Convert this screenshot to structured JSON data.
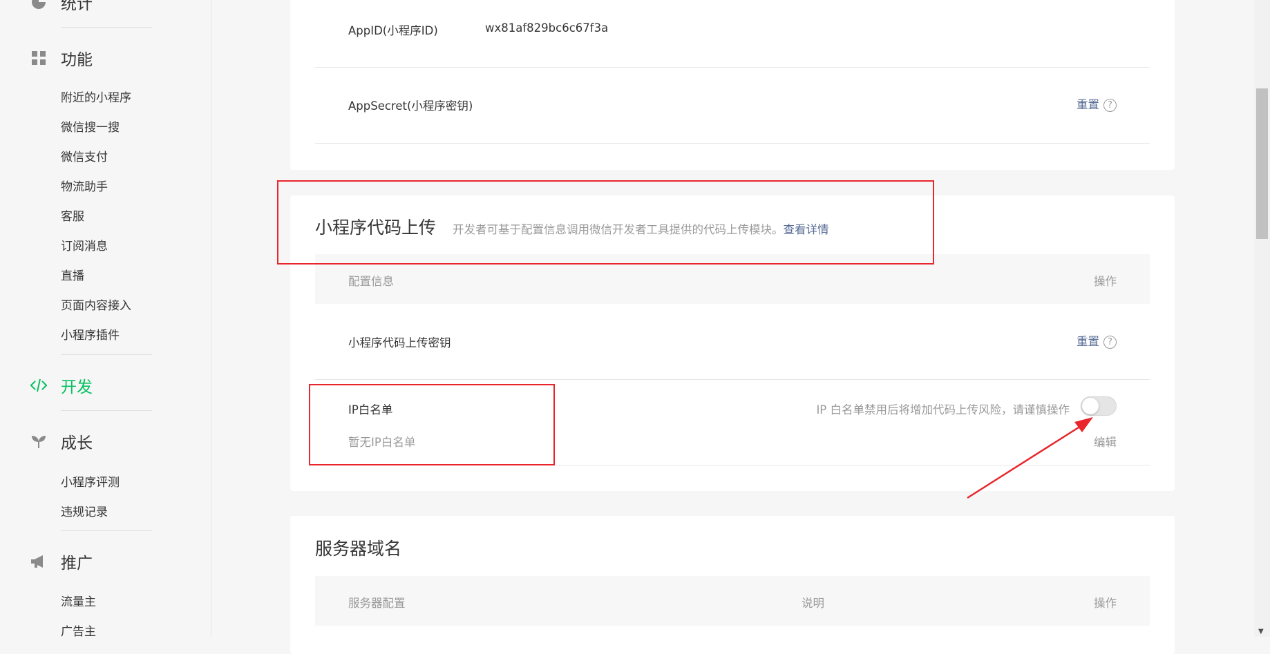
{
  "sidebar": {
    "stats_label": "统计",
    "features": {
      "label": "功能",
      "items": [
        "附近的小程序",
        "微信搜一搜",
        "微信支付",
        "物流助手",
        "客服",
        "订阅消息",
        "直播",
        "页面内容接入",
        "小程序插件"
      ]
    },
    "develop": {
      "label": "开发"
    },
    "growth": {
      "label": "成长",
      "items": [
        "小程序评测",
        "违规记录"
      ]
    },
    "promote": {
      "label": "推广",
      "items": [
        "流量主",
        "广告主"
      ]
    },
    "active_color": "#07c160"
  },
  "account_card": {
    "appid_label": "AppID(小程序ID)",
    "appid_value": "wx81af829bc6c67f3a",
    "appsecret_label": "AppSecret(小程序密钥)",
    "appsecret_action": "重置"
  },
  "upload_card": {
    "title": "小程序代码上传",
    "description": "开发者可基于配置信息调用微信开发者工具提供的代码上传模块。",
    "details_link": "查看详情",
    "header_config": "配置信息",
    "header_action": "操作",
    "key_label": "小程序代码上传密钥",
    "key_action": "重置",
    "ip_label": "IP白名单",
    "ip_empty": "暂无IP白名单",
    "ip_warning": "IP 白名单禁用后将增加代码上传风险，请谨慎操作",
    "ip_toggle_on": false,
    "ip_edit": "编辑"
  },
  "server_card": {
    "title": "服务器域名",
    "header_config": "服务器配置",
    "header_desc": "说明",
    "header_action": "操作"
  },
  "colors": {
    "link": "#576b95",
    "annotation_red": "#e8262b"
  }
}
